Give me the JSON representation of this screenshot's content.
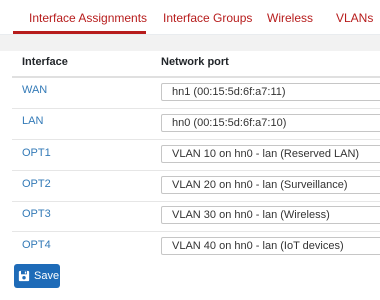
{
  "tabs": [
    {
      "label": "Interface Assignments",
      "active": true
    },
    {
      "label": "Interface Groups",
      "active": false
    },
    {
      "label": "Wireless",
      "active": false
    },
    {
      "label": "VLANs",
      "active": false
    }
  ],
  "table": {
    "headers": {
      "interface": "Interface",
      "network_port": "Network port"
    },
    "rows": [
      {
        "interface": "WAN",
        "port": "hn1 (00:15:5d:6f:a7:11)"
      },
      {
        "interface": "LAN",
        "port": "hn0 (00:15:5d:6f:a7:10)"
      },
      {
        "interface": "OPT1",
        "port": "VLAN 10 on hn0 - lan (Reserved LAN)"
      },
      {
        "interface": "OPT2",
        "port": "VLAN 20 on hn0 - lan (Surveillance)"
      },
      {
        "interface": "OPT3",
        "port": "VLAN 30 on hn0 - lan (Wireless)"
      },
      {
        "interface": "OPT4",
        "port": "VLAN 40 on hn0 - lan (IoT devices)"
      }
    ]
  },
  "save_button": {
    "label": "Save",
    "icon": "save-icon"
  },
  "colors": {
    "accent": "#b71c1c",
    "link": "#337ab7",
    "button": "#1e6bb8"
  }
}
